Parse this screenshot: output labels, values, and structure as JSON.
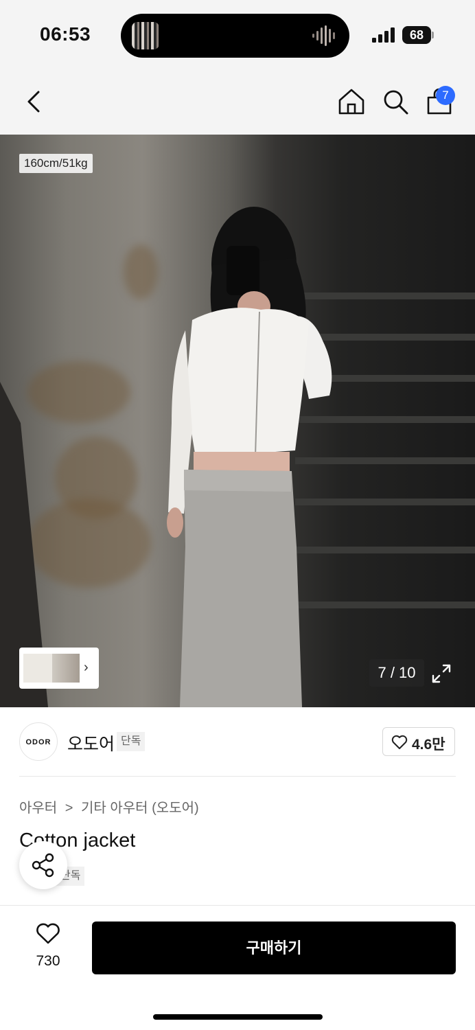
{
  "status_bar": {
    "time": "06:53",
    "battery": "68"
  },
  "nav": {
    "cart_count": "7"
  },
  "hero": {
    "model_size": "160cm/51kg",
    "page_counter": "7 / 10",
    "thumbnail_chevron": "›"
  },
  "brand": {
    "logo_text": "ODOR",
    "name": "오도어",
    "tag": "단독",
    "likes": "4.6만"
  },
  "product": {
    "breadcrumb": [
      "아우터",
      "기타 아우터 (오도어)"
    ],
    "breadcrumb_separator": ">",
    "title": "Cotton jacket",
    "tag": "단독"
  },
  "action_bar": {
    "like_count": "730",
    "buy_label": "구매하기"
  },
  "colors": {
    "badge": "#2d6bff",
    "buy_button": "#000000"
  }
}
